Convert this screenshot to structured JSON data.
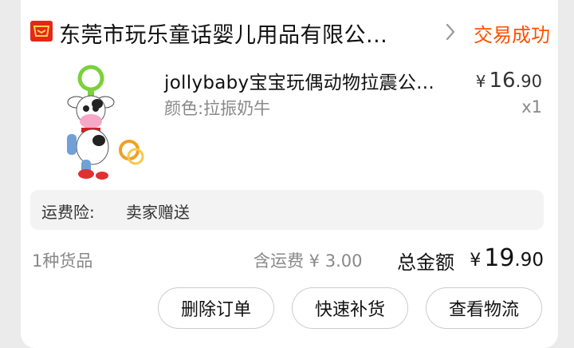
{
  "order": {
    "shop_name": "东莞市玩乐童话婴儿用品有限公...",
    "status": "交易成功",
    "product": {
      "title": "jollybaby宝宝玩偶动物拉震公...",
      "variant": "颜色:拉振奶牛",
      "price_currency": "¥",
      "price_int": "16",
      "price_dec": ".90",
      "quantity": "x1"
    },
    "insurance": {
      "label": "运费险:",
      "value": "卖家赠送"
    },
    "summary": {
      "item_count": "1种货品",
      "shipping": "含运费 ¥ 3.00",
      "total_label": "总金额",
      "total_currency": "¥",
      "total_int": "19",
      "total_dec": ".90"
    },
    "actions": {
      "delete": "删除订单",
      "restock": "快速补货",
      "logistics": "查看物流"
    }
  },
  "colors": {
    "accent": "#ff5000",
    "shop_icon": "#e5261b",
    "page_bg": "#ebebeb"
  },
  "icons": {
    "shop": "tmall-shop-icon",
    "chevron": "chevron-right-icon"
  }
}
